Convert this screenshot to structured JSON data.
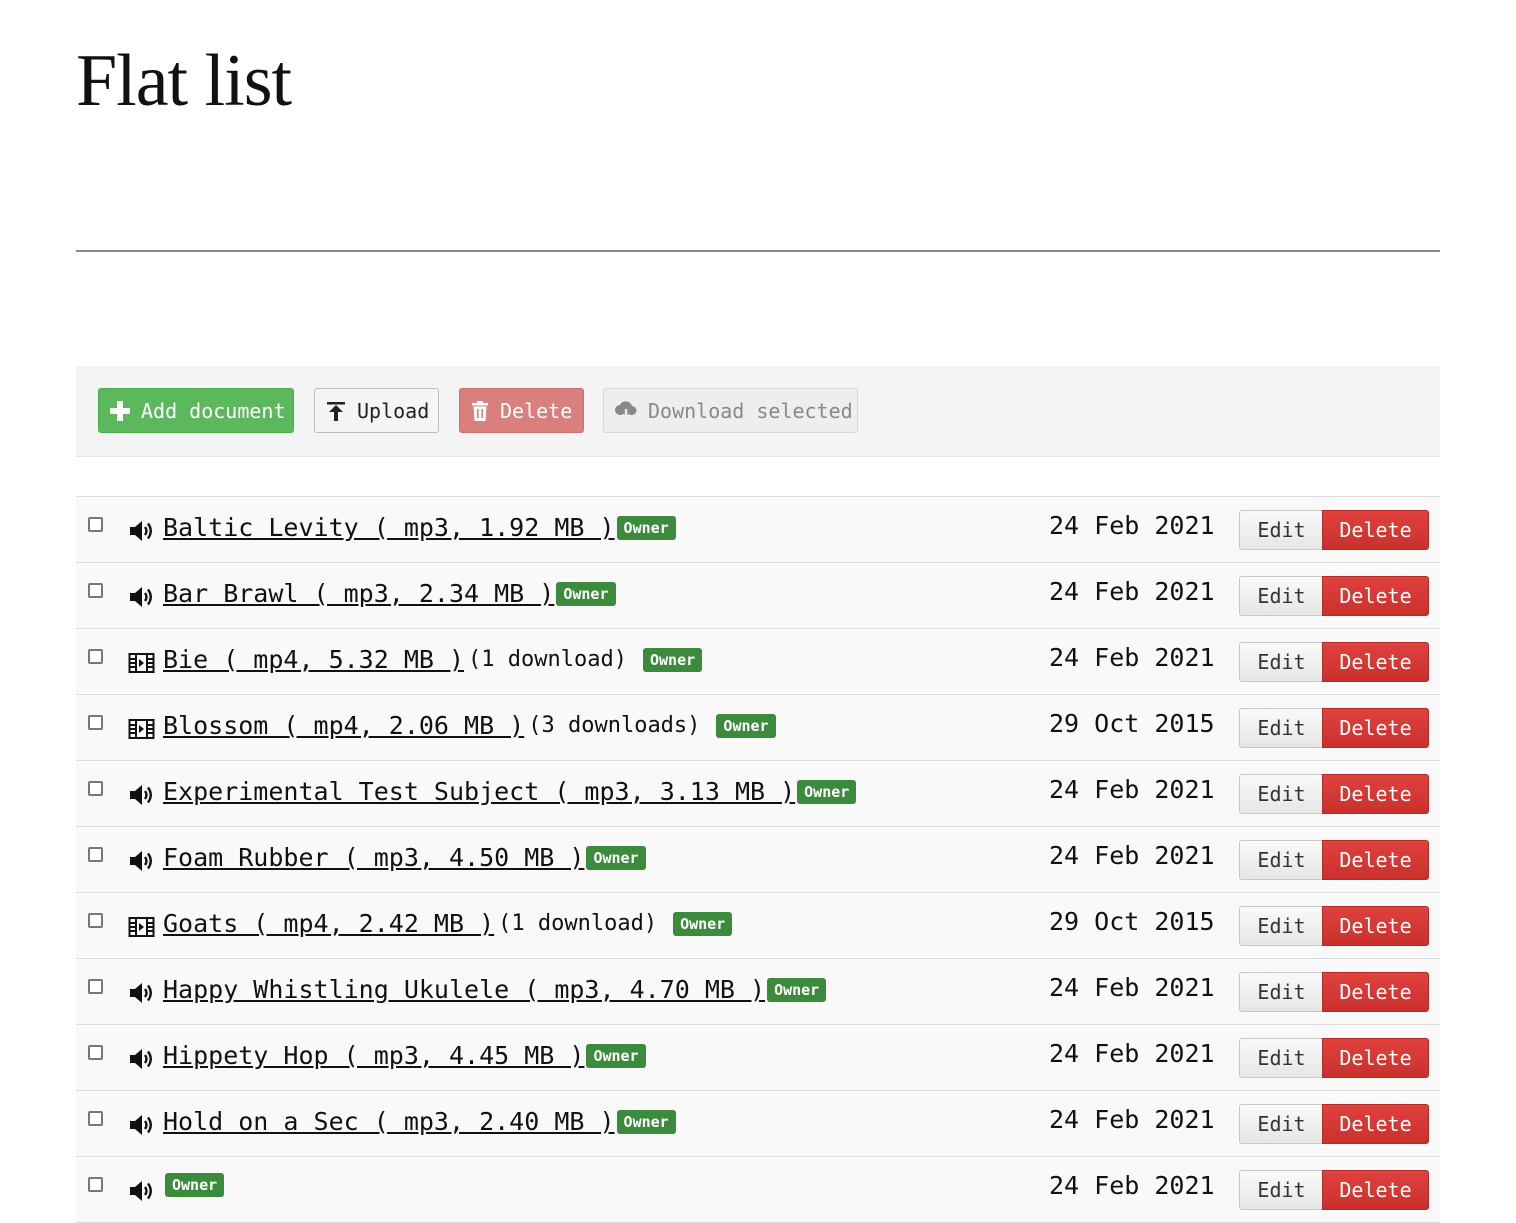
{
  "page": {
    "title": "Flat list"
  },
  "toolbar": {
    "add_label": "Add document",
    "upload_label": "Upload",
    "delete_label": "Delete",
    "download_label": "Download selected"
  },
  "row_actions": {
    "edit_label": "Edit",
    "delete_label": "Delete"
  },
  "documents": [
    {
      "icon": "audio-icon",
      "link": "Baltic Levity ( mp3, 1.92 MB )",
      "downloads": "",
      "badge": "Owner",
      "date": "24 Feb 2021"
    },
    {
      "icon": "audio-icon",
      "link": "Bar Brawl ( mp3, 2.34 MB )",
      "downloads": "",
      "badge": "Owner",
      "date": "24 Feb 2021"
    },
    {
      "icon": "video-icon",
      "link": "Bie ( mp4, 5.32 MB )",
      "downloads": "(1 download)",
      "badge": "Owner",
      "date": "24 Feb 2021"
    },
    {
      "icon": "video-icon",
      "link": "Blossom ( mp4, 2.06 MB )",
      "downloads": "(3 downloads)",
      "badge": "Owner",
      "date": "29 Oct 2015"
    },
    {
      "icon": "audio-icon",
      "link": "Experimental Test Subject ( mp3, 3.13 MB )",
      "downloads": "",
      "badge": "Owner",
      "date": "24 Feb 2021"
    },
    {
      "icon": "audio-icon",
      "link": "Foam Rubber ( mp3, 4.50 MB )",
      "downloads": "",
      "badge": "Owner",
      "date": "24 Feb 2021"
    },
    {
      "icon": "video-icon",
      "link": "Goats ( mp4, 2.42 MB )",
      "downloads": "(1 download)",
      "badge": "Owner",
      "date": "29 Oct 2015"
    },
    {
      "icon": "audio-icon",
      "link": "Happy Whistling Ukulele ( mp3, 4.70 MB )",
      "downloads": "",
      "badge": "Owner",
      "date": "24 Feb 2021"
    },
    {
      "icon": "audio-icon",
      "link": "Hippety Hop ( mp3, 4.45 MB )",
      "downloads": "",
      "badge": "Owner",
      "date": "24 Feb 2021"
    },
    {
      "icon": "audio-icon",
      "link": "Hold on a Sec ( mp3, 2.40 MB )",
      "downloads": "",
      "badge": "Owner",
      "date": "24 Feb 2021"
    },
    {
      "icon": "audio-icon",
      "link": "",
      "downloads": "",
      "badge": "Owner",
      "date": "24 Feb 2021"
    }
  ]
}
